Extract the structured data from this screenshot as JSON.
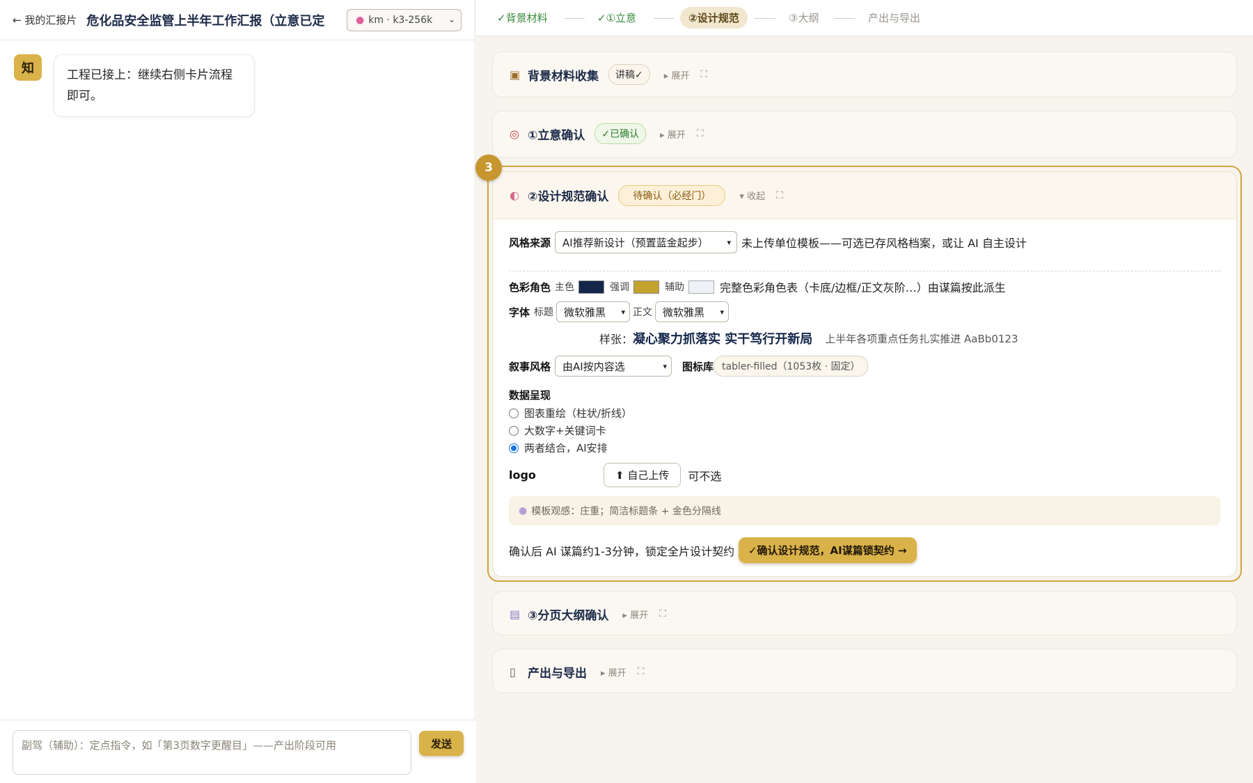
{
  "left": {
    "back_label": "← 我的汇报片",
    "doc_title": "危化品安全监管上半年工作汇报（立意已定",
    "model": {
      "icon": "brain-icon",
      "value": "km · k3-256k"
    },
    "messages": [
      {
        "avatar": "知",
        "text": "工程已接上：继续右侧卡片流程即可。"
      }
    ],
    "composer": {
      "placeholder": "副驾（辅助）：定点指令，如「第3页数字更醒目」——产出阶段可用",
      "send_label": "发送"
    }
  },
  "steps": [
    {
      "label": "✓背景材料",
      "state": "done"
    },
    {
      "label": "✓①立意",
      "state": "done"
    },
    {
      "label": "②设计规范",
      "state": "current"
    },
    {
      "label": "③大纲",
      "state": "pending"
    },
    {
      "label": "产出与导出",
      "state": "pending"
    }
  ],
  "cards": {
    "background": {
      "icon": "package-icon",
      "title": "背景材料收集",
      "tag": "讲稿✓",
      "toggle": "▸ 展开"
    },
    "intent": {
      "icon": "target-icon",
      "title": "①立意确认",
      "tag": "✓已确认",
      "toggle": "▸ 展开"
    },
    "design": {
      "badge": "3",
      "icon": "palette-icon",
      "title": "②设计规范确认",
      "tag": "待确认（必经门）",
      "toggle": "▾ 收起",
      "style_source": {
        "label": "风格来源",
        "value": "AI推荐新设计（预置蓝金起步）",
        "hint": "未上传单位模板——可选已存风格档案，或让 AI 自主设计"
      },
      "colors": {
        "label": "色彩角色",
        "primary_label": "主色",
        "primary": "#14264a",
        "accent_label": "强调",
        "accent": "#c4a22e",
        "aux_label": "辅助",
        "aux": "#eef2f7",
        "hint": "完整色彩角色表（卡底/边框/正文灰阶…）由谋篇按此派生"
      },
      "fonts": {
        "label": "字体",
        "title_label": "标题",
        "title_font": "微软雅黑",
        "body_label": "正文",
        "body_font": "微软雅黑"
      },
      "sample": {
        "prefix": "样张：",
        "title": "凝心聚力抓落实 实干笃行开新局",
        "body": "上半年各项重点任务扎实推进 AaBb0123"
      },
      "narrative": {
        "label": "叙事风格",
        "value": "由AI按内容选"
      },
      "icon_lib": {
        "label": "图标库",
        "value": "tabler-filled（1053枚 · 固定）"
      },
      "data_presentation": {
        "label": "数据呈现",
        "options": [
          "图表重绘（柱状/折线）",
          "大数字+关键词卡",
          "两者结合，AI安排"
        ],
        "selected_index": 2
      },
      "logo": {
        "label": "logo",
        "button": "⬆ 自己上传",
        "hint": "可不选"
      },
      "template_note": {
        "icon": "speech-bubble-icon",
        "text": "模板观感：庄重；简洁标题条 + 金色分隔线"
      },
      "confirm": {
        "hint": "确认后 AI 谋篇约1-3分钟，锁定全片设计契约",
        "button": "✓确认设计规范，AI谋篇锁契约 →"
      }
    },
    "outline": {
      "icon": "notepad-icon",
      "title": "③分页大纲确认",
      "toggle": "▸ 展开"
    },
    "export": {
      "icon": "phone-icon",
      "title": "产出与导出",
      "toggle": "▸ 展开"
    }
  }
}
